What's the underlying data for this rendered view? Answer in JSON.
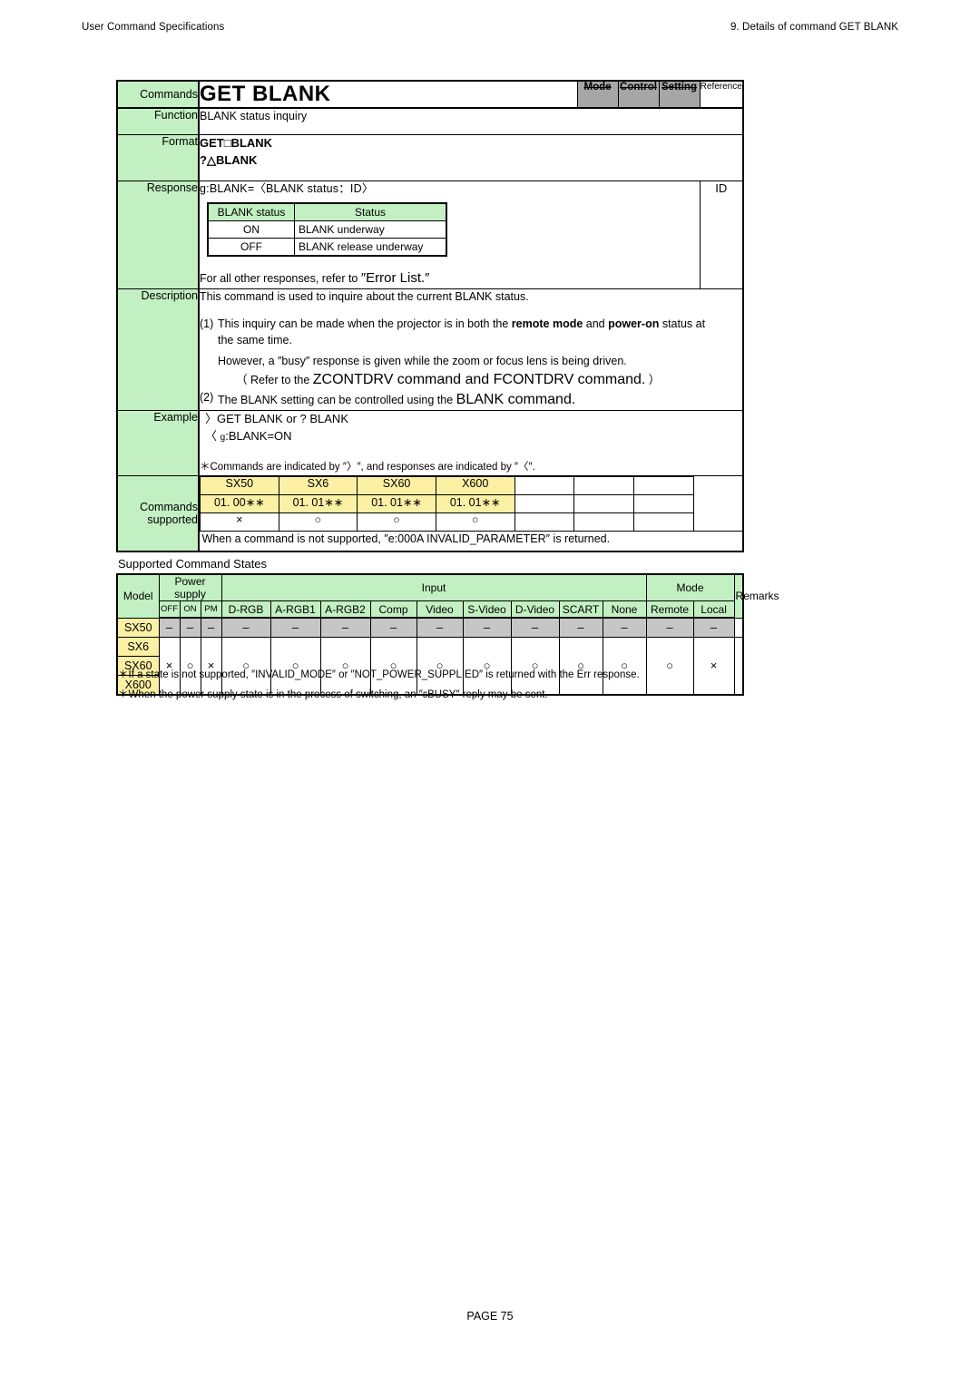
{
  "header": {
    "left": "User Command Specifications",
    "right": "9. Details of command  GET BLANK"
  },
  "command": {
    "label_commands": "Commands",
    "title": "GET BLANK",
    "flags": [
      {
        "label": "Mode",
        "state": "off"
      },
      {
        "label": "Control",
        "state": "off"
      },
      {
        "label": "Setting",
        "state": "off"
      },
      {
        "label": "Reference",
        "state": "on"
      }
    ],
    "label_function": "Function",
    "function_text": "BLANK status inquiry",
    "label_format": "Format",
    "format_lines": [
      "GET□BLANK",
      "?△BLANK"
    ],
    "label_response": "Response",
    "response_signature": "g:BLANK=〈BLANK status：ID〉",
    "status_table": {
      "headers": [
        "BLANK status",
        "Status"
      ],
      "rows": [
        [
          "ON",
          "BLANK underway"
        ],
        [
          "OFF",
          "BLANK release underway"
        ]
      ]
    },
    "response_note_pre": "For all other responses, refer to ",
    "response_note_big": "″Error List.″",
    "id_label": "ID",
    "label_description": "Description",
    "description": {
      "lead": "This command is used to inquire about the current BLANK status.",
      "item1_num": "(1)",
      "item1_a_pre": "This inquiry can be made when the projector is in both the ",
      "item1_a_b1": "remote mode",
      "item1_a_mid": " and ",
      "item1_a_b2": "power-on",
      "item1_a_post": " status at",
      "item1_b": "the same time.",
      "item1_c": "However, a ″busy″ response is given while the zoom or focus lens is being driven.",
      "item1_d_pre": "（ Refer to the ",
      "item1_d_big": "ZCONTDRV command and FCONTDRV command.",
      "item1_d_post": " ）",
      "item2_num": "(2)",
      "item2_pre": "The BLANK setting can be controlled using the ",
      "item2_big": "BLANK command."
    },
    "label_example": "Example",
    "example": {
      "line1": "〉GET BLANK or ? BLANK",
      "line2_arrow": "〈",
      "line2_g": "g",
      "line2_rest": ":BLANK=ON",
      "note": "＊Commands are indicated by ″〉″, and responses are indicated by ″〈″."
    },
    "label_commands_supported_1": "Commands",
    "label_commands_supported_2": "supported",
    "supported": {
      "models": [
        "SX50",
        "SX6",
        "SX60",
        "X600"
      ],
      "versions": [
        "01. 00∗∗",
        "01. 01∗∗",
        "01. 01∗∗",
        "01. 01∗∗"
      ],
      "marks": [
        "×",
        "○",
        "○",
        "○"
      ],
      "empty_cols": 3,
      "note": "When a command is not supported, ″e:000A INVALID_PARAMETER″ is returned."
    }
  },
  "states": {
    "title": "Supported Command States",
    "group_headers": {
      "model": "Model",
      "power_supply": "Power supply",
      "input": "Input",
      "mode": "Mode",
      "remarks": "Remarks"
    },
    "sub_headers": {
      "power": [
        "OFF",
        "ON",
        "PM"
      ],
      "input": [
        "D-RGB",
        "A-RGB1",
        "A-RGB2",
        "Comp",
        "Video",
        "S-Video",
        "D-Video",
        "SCART",
        "None"
      ],
      "mode": [
        "Remote",
        "Local"
      ]
    },
    "rows": [
      {
        "models": [
          "SX50"
        ],
        "power": [
          "–",
          "–",
          "–"
        ],
        "input": [
          "–",
          "–",
          "–",
          "–",
          "–",
          "–",
          "–",
          "–",
          "–"
        ],
        "mode": [
          "–",
          "–"
        ],
        "remarks": "",
        "style": "gray"
      },
      {
        "models": [
          "SX6",
          "SX60",
          "X600"
        ],
        "power": [
          "×",
          "○",
          "×"
        ],
        "input": [
          "○",
          "○",
          "○",
          "○",
          "○",
          "○",
          "○",
          "○",
          "○"
        ],
        "mode": [
          "○",
          "×"
        ],
        "remarks": "",
        "style": "white"
      }
    ],
    "notes": [
      "＊If a state is not supported, ″INVALID_MODE″ or ″NOT_POWER_SUPPLIED″ is returned with the Err response.",
      "＊When the power supply state is in the process of switching, an ″ɛBUSY″ reply may be sent."
    ]
  },
  "footer": {
    "page": "PAGE 75"
  }
}
